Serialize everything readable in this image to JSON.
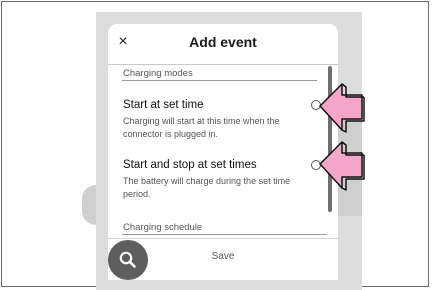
{
  "dialog": {
    "title": "Add event",
    "close_glyph": "×",
    "close_icon": "close-icon"
  },
  "sections": {
    "charging_modes": "Charging modes",
    "charging_schedule": "Charging schedule"
  },
  "options": [
    {
      "title": "Start at set time",
      "description": "Charging will  start at this time when the connector is plugged in.",
      "selected": false
    },
    {
      "title": "Start and stop at set times",
      "description": "The battery will charge during the set time period.",
      "selected": false
    }
  ],
  "footer": {
    "save_label": "Save",
    "fab_icon": "search-icon"
  },
  "colors": {
    "callout_arrow": "#f4a6c8",
    "fab": "#5e5e5e"
  }
}
